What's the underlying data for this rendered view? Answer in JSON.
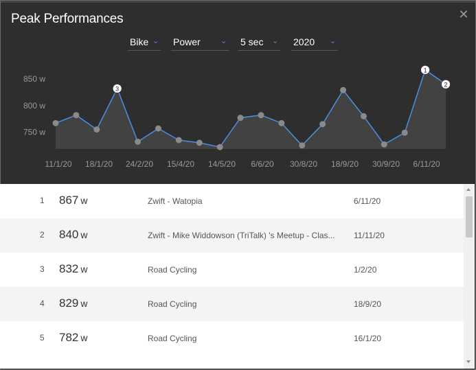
{
  "title": "Peak Performances",
  "close_icon": "close-icon",
  "filters": {
    "sport": "Bike",
    "metric": "Power",
    "duration": "5 sec",
    "year": "2020"
  },
  "chart_data": {
    "type": "line",
    "y_ticks": [
      "850 w",
      "800 w",
      "750 w"
    ],
    "y_tick_values": [
      850,
      800,
      750
    ],
    "x_ticks": [
      "11/1/20",
      "18/1/20",
      "24/2/20",
      "15/4/20",
      "14/5/20",
      "6/6/20",
      "30/8/20",
      "18/9/20",
      "30/9/20",
      "6/11/20"
    ],
    "values": [
      767,
      782,
      755,
      832,
      732,
      757,
      735,
      730,
      722,
      777,
      782,
      767,
      725,
      765,
      829,
      780,
      727,
      749,
      867,
      840
    ],
    "ylim": [
      720,
      880
    ],
    "markers": [
      {
        "index": 18,
        "label": "1"
      },
      {
        "index": 19,
        "label": "2"
      },
      {
        "index": 3,
        "label": "3"
      }
    ],
    "colors": {
      "line": "#4a90e2",
      "area": "#4a4a4a",
      "point": "#8a8a8a"
    }
  },
  "rows": [
    {
      "rank": "1",
      "power": "867",
      "unit": "w",
      "activity": "Zwift - Watopia",
      "date": "6/11/20"
    },
    {
      "rank": "2",
      "power": "840",
      "unit": "w",
      "activity": "Zwift - Mike Widdowson (TriTalk) 's Meetup - Clas...",
      "date": "11/11/20"
    },
    {
      "rank": "3",
      "power": "832",
      "unit": "w",
      "activity": "Road Cycling",
      "date": "1/2/20"
    },
    {
      "rank": "4",
      "power": "829",
      "unit": "w",
      "activity": "Road Cycling",
      "date": "18/9/20"
    },
    {
      "rank": "5",
      "power": "782",
      "unit": "w",
      "activity": "Road Cycling",
      "date": "16/1/20"
    }
  ]
}
